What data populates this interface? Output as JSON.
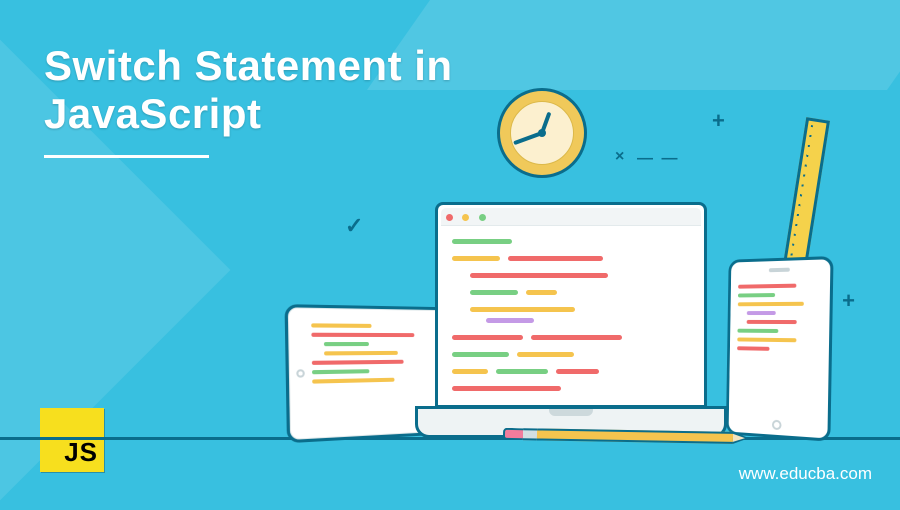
{
  "title_line1": "Switch Statement in",
  "title_line2": "JavaScript",
  "website": "www.educba.com",
  "js_badge": "JS",
  "glyphs": {
    "check": "✓",
    "x1": "×",
    "dash": "— —",
    "plus1": "+",
    "plus2": "+",
    "x2": "×",
    "plus3": "+"
  }
}
